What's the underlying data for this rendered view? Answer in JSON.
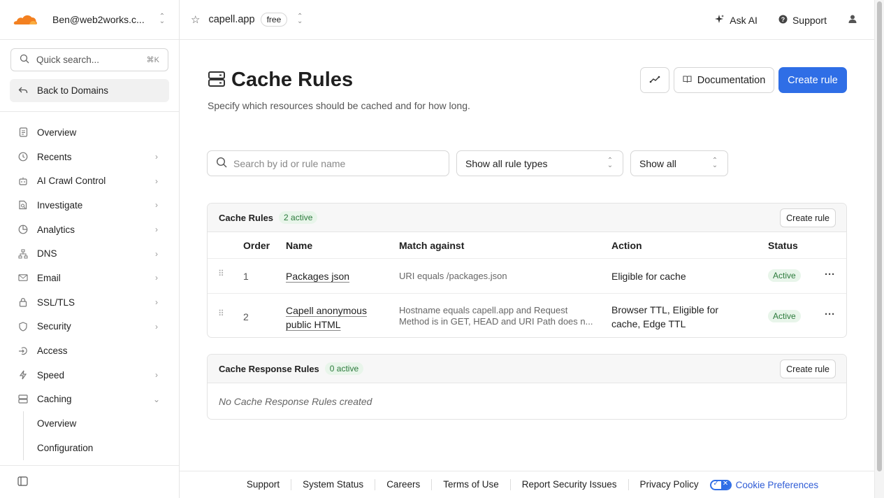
{
  "sidebar": {
    "account": "Ben@web2works.c...",
    "search_placeholder": "Quick search...",
    "search_shortcut": "⌘K",
    "back_label": "Back to Domains",
    "items": [
      {
        "label": "Overview",
        "icon": "document-icon",
        "chevron": false
      },
      {
        "label": "Recents",
        "icon": "clock-icon",
        "chevron": true
      },
      {
        "label": "AI Crawl Control",
        "icon": "robot-icon",
        "chevron": true
      },
      {
        "label": "Investigate",
        "icon": "investigate-icon",
        "chevron": true
      },
      {
        "label": "Analytics",
        "icon": "pie-icon",
        "chevron": true
      },
      {
        "label": "DNS",
        "icon": "network-icon",
        "chevron": true
      },
      {
        "label": "Email",
        "icon": "mail-icon",
        "chevron": true
      },
      {
        "label": "SSL/TLS",
        "icon": "lock-icon",
        "chevron": true
      },
      {
        "label": "Security",
        "icon": "shield-icon",
        "chevron": true
      },
      {
        "label": "Access",
        "icon": "login-icon",
        "chevron": false
      },
      {
        "label": "Speed",
        "icon": "bolt-icon",
        "chevron": true
      },
      {
        "label": "Caching",
        "icon": "server-icon",
        "chevron": "down"
      }
    ],
    "subitems": [
      {
        "label": "Overview"
      },
      {
        "label": "Configuration"
      }
    ]
  },
  "topbar": {
    "domain": "capell.app",
    "plan": "free",
    "ask_ai": "Ask AI",
    "support": "Support"
  },
  "page": {
    "title": "Cache Rules",
    "subtitle": "Specify which resources should be cached and for how long.",
    "documentation": "Documentation",
    "create_rule": "Create rule"
  },
  "filters": {
    "search_placeholder": "Search by id or rule name",
    "rule_types": "Show all rule types",
    "show": "Show all"
  },
  "cache_rules": {
    "title": "Cache Rules",
    "badge": "2 active",
    "create": "Create rule",
    "columns": [
      "Order",
      "Name",
      "Match against",
      "Action",
      "Status"
    ],
    "rows": [
      {
        "order": "1",
        "name_lines": [
          "Packages json"
        ],
        "match_lines": [
          "URI equals /packages.json"
        ],
        "action_lines": [
          "Eligible for cache"
        ],
        "status": "Active"
      },
      {
        "order": "2",
        "name_lines": [
          "Capell anonymous",
          "public HTML"
        ],
        "match_lines": [
          "Hostname equals capell.app and Request",
          "Method is in GET, HEAD and URI Path does n..."
        ],
        "action_lines": [
          "Browser TTL, Eligible for",
          "cache, Edge TTL"
        ],
        "status": "Active"
      }
    ]
  },
  "response_rules": {
    "title": "Cache Response Rules",
    "badge": "0 active",
    "create": "Create rule",
    "empty": "No Cache Response Rules created"
  },
  "footer": {
    "links": [
      "Support",
      "System Status",
      "Careers",
      "Terms of Use",
      "Report Security Issues",
      "Privacy Policy"
    ],
    "cookie": "Cookie Preferences"
  },
  "colors": {
    "accent": "#2f6ee6",
    "logo_orange": "#f38020",
    "active_green": "#2b7a3b"
  }
}
